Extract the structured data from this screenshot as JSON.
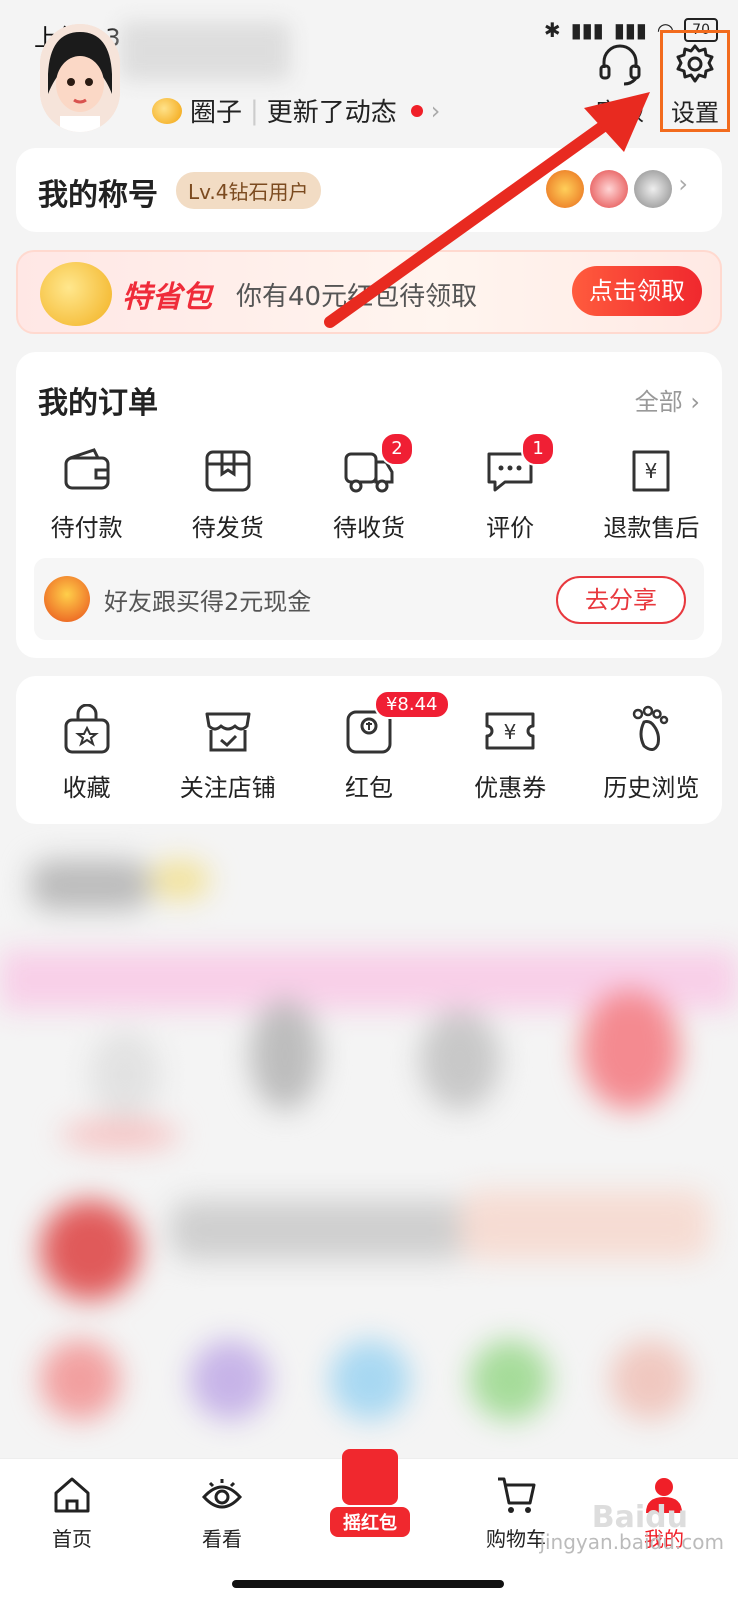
{
  "status_bar": {
    "time": "上午6:3",
    "battery": "70"
  },
  "header": {
    "quanzi": "圈子",
    "update_text": "更新了动态",
    "kefu_label": "客服",
    "settings_label": "设置"
  },
  "title_card": {
    "label": "我的称号",
    "level_badge": "Lv.4钻石用户"
  },
  "promo": {
    "brand": "特省包",
    "text": "你有40元红包待领取",
    "button": "点击领取"
  },
  "orders": {
    "title": "我的订单",
    "all_label": "全部",
    "items": [
      {
        "label": "待付款",
        "icon": "wallet-icon"
      },
      {
        "label": "待发货",
        "icon": "box-icon"
      },
      {
        "label": "待收货",
        "icon": "truck-icon",
        "badge": "2"
      },
      {
        "label": "评价",
        "icon": "comment-icon",
        "badge": "1"
      },
      {
        "label": "退款售后",
        "icon": "refund-icon"
      }
    ],
    "share_text": "好友跟买得2元现金",
    "share_button": "去分享"
  },
  "tools": {
    "items": [
      {
        "label": "收藏",
        "icon": "favorite-bag-icon"
      },
      {
        "label": "关注店铺",
        "icon": "store-icon"
      },
      {
        "label": "红包",
        "icon": "red-packet-icon",
        "badge": "¥8.44"
      },
      {
        "label": "优惠券",
        "icon": "coupon-icon"
      },
      {
        "label": "历史浏览",
        "icon": "footprint-icon"
      }
    ]
  },
  "tabbar": {
    "home": "首页",
    "look": "看看",
    "shake": "摇红包",
    "cart": "购物车",
    "me": "我的"
  },
  "watermark": {
    "site": "jingyan.baidu.com",
    "logo": "Baidu"
  },
  "colors": {
    "accent": "#f01f28",
    "highlight_box": "#f26b1d",
    "bg": "#f4f4f4"
  }
}
